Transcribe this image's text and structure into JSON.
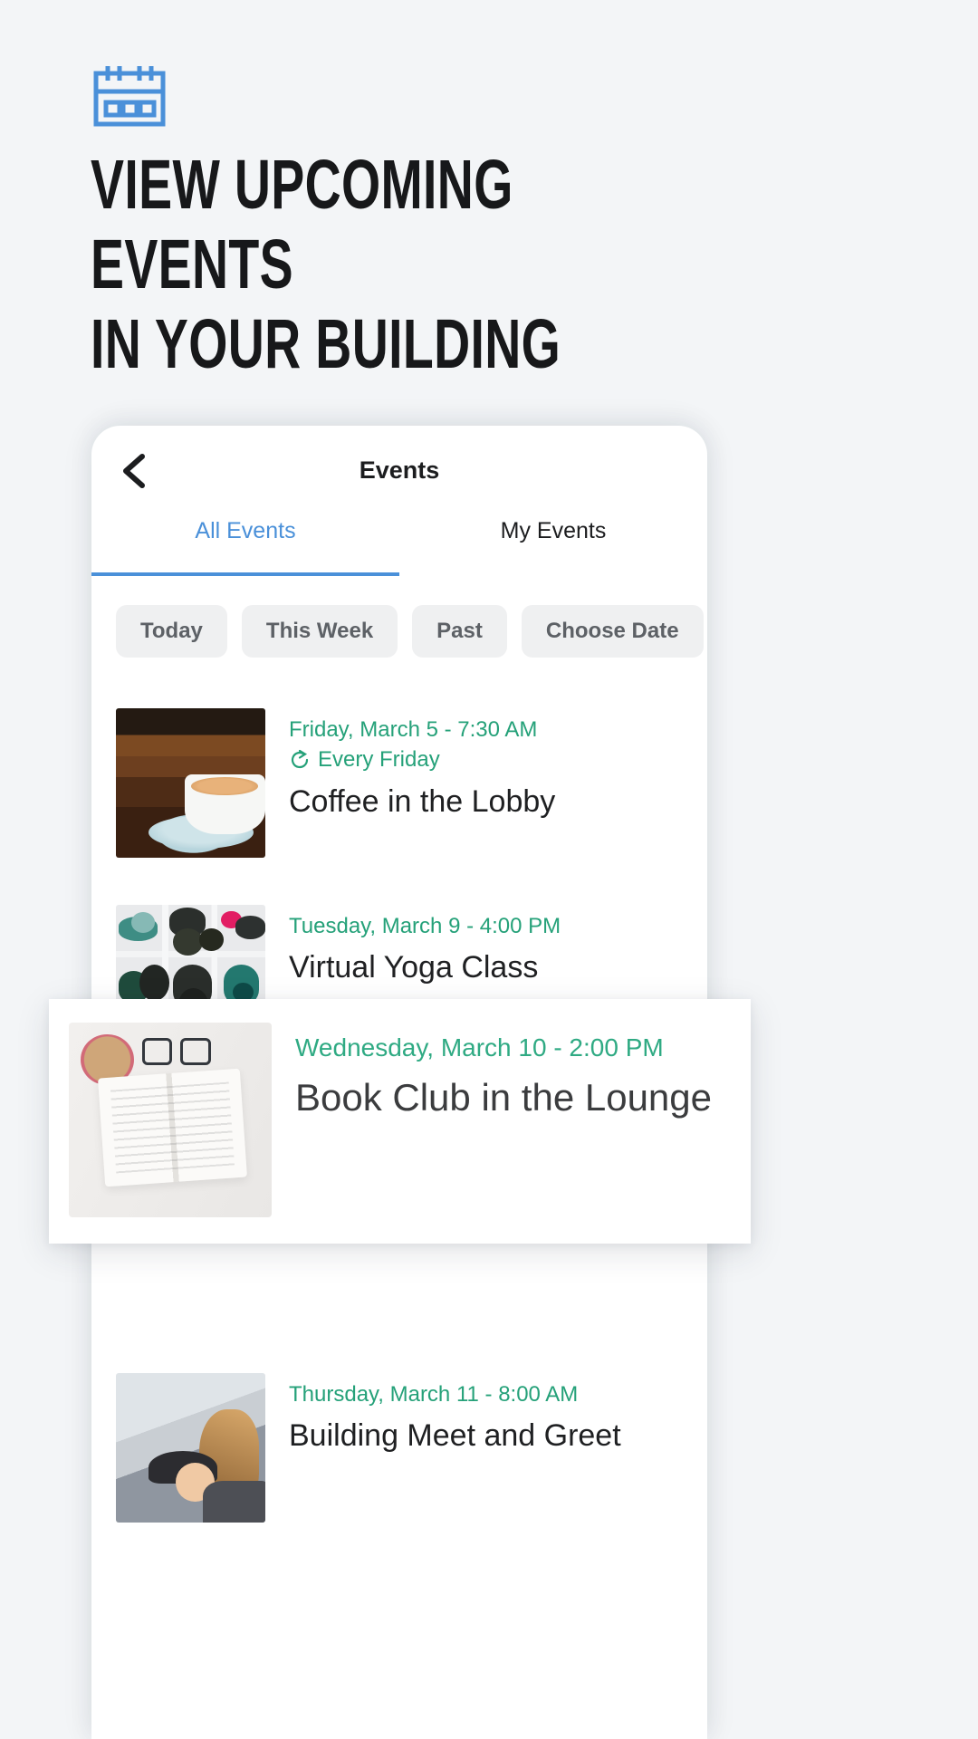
{
  "theme": {
    "page_bg": "#f3f5f7",
    "accent_blue": "#4a90d9",
    "accent_green": "#25a179",
    "chip_bg": "#eff0f1",
    "text_dark": "#1c1d1f"
  },
  "hero": {
    "icon": "calendar-icon",
    "headline": "VIEW UPCOMING EVENTS\nIN YOUR BUILDING"
  },
  "app": {
    "back_icon": "chevron-left-icon",
    "title": "Events",
    "tabs": [
      {
        "label": "All Events",
        "active": true
      },
      {
        "label": "My Events",
        "active": false
      }
    ],
    "filters": [
      {
        "label": "Today"
      },
      {
        "label": "This Week"
      },
      {
        "label": "Past"
      },
      {
        "label": "Choose Date"
      }
    ],
    "events": [
      {
        "date": "Friday, March 5 - 7:30 AM",
        "repeat": "Every Friday",
        "repeat_icon": "refresh-icon",
        "title": "Coffee in the Lobby",
        "thumb": "coffee-cup-photo"
      },
      {
        "date": "Tuesday, March 9 - 4:00 PM",
        "repeat": "",
        "title": "Virtual Yoga Class",
        "thumb": "yoga-mats-photo"
      },
      {
        "date": "Wednesday, March 10 - 2:00 PM",
        "repeat": "",
        "title": "Book Club in the Lounge",
        "thumb": "open-book-photo",
        "highlighted": true
      },
      {
        "date": "Thursday, March 11 - 8:00 AM",
        "repeat": "",
        "title": "Building Meet and Greet",
        "thumb": "people-smiling-photo"
      }
    ]
  }
}
